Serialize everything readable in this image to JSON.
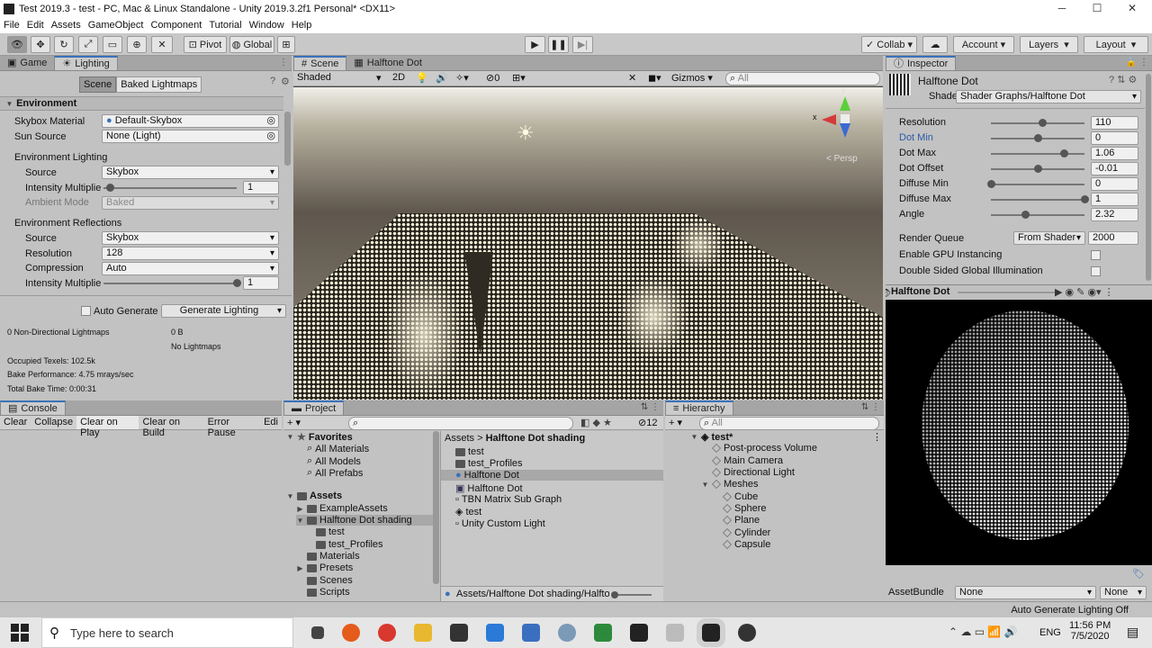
{
  "window": {
    "title": "Test 2019.3 - test - PC, Mac & Linux Standalone - Unity 2019.3.2f1 Personal* <DX11>",
    "min": "─",
    "max": "☐",
    "close": "✕"
  },
  "menu": [
    "File",
    "Edit",
    "Assets",
    "GameObject",
    "Component",
    "Tutorial",
    "Window",
    "Help"
  ],
  "toolbar": {
    "pivot": "Pivot",
    "global": "Global",
    "collab": "Collab",
    "account": "Account",
    "layers": "Layers",
    "layout": "Layout"
  },
  "lighting": {
    "tabs": [
      "Game",
      "Lighting"
    ],
    "subtabs": [
      "Scene",
      "Baked Lightmaps"
    ],
    "environment": "Environment",
    "skybox_label": "Skybox Material",
    "skybox_value": "Default-Skybox",
    "sun_label": "Sun Source",
    "sun_value": "None (Light)",
    "env_lighting": "Environment Lighting",
    "source_label": "Source",
    "source_value": "Skybox",
    "intensity_label": "Intensity Multiplie",
    "intensity_value": "1",
    "intensity_level": 0.05,
    "ambient_label": "Ambient Mode",
    "ambient_value": "Baked",
    "env_reflections": "Environment Reflections",
    "refl_source_label": "Source",
    "refl_source_value": "Skybox",
    "resolution_label": "Resolution",
    "resolution_value": "128",
    "compression_label": "Compression",
    "compression_value": "Auto",
    "refl_intensity_label": "Intensity Multiplie",
    "refl_intensity_value": "1",
    "refl_intensity_level": 1.0,
    "auto_generate": "Auto Generate",
    "generate": "Generate Lighting",
    "stats": {
      "nondir": "0 Non-Directional Lightmaps",
      "size": "0 B",
      "nolightmaps": "No Lightmaps",
      "texels": "Occupied Texels: 102.5k",
      "perf": "Bake Performance: 4.75 mrays/sec",
      "time": "Total Bake Time: 0:00:31"
    }
  },
  "scene": {
    "tabs": [
      "Scene",
      "Halftone Dot"
    ],
    "shading": "Shaded",
    "mode2d": "2D",
    "fx_count": "0",
    "gizmos": "Gizmos",
    "search": "All",
    "persp": "Persp",
    "axis_x": "x",
    "axis_y": "y"
  },
  "inspector": {
    "tab": "Inspector",
    "name": "Halftone Dot",
    "shader_label": "Shader",
    "shader_value": "Shader Graphs/Halftone Dot",
    "props": [
      {
        "label": "Resolution",
        "value": "110",
        "level": 0.55,
        "highlight": false
      },
      {
        "label": "Dot Min",
        "value": "0",
        "level": 0.5,
        "highlight": true
      },
      {
        "label": "Dot Max",
        "value": "1.06",
        "level": 0.78,
        "highlight": false
      },
      {
        "label": "Dot Offset",
        "value": "-0.01",
        "level": 0.5,
        "highlight": false
      },
      {
        "label": "Diffuse Min",
        "value": "0",
        "level": 0.0,
        "highlight": false
      },
      {
        "label": "Diffuse Max",
        "value": "1",
        "level": 1.0,
        "highlight": false
      },
      {
        "label": "Angle",
        "value": "2.32",
        "level": 0.37,
        "highlight": false
      }
    ],
    "render_queue_label": "Render Queue",
    "render_queue_mode": "From Shader",
    "render_queue_value": "2000",
    "gpu_instancing": "Enable GPU Instancing",
    "double_sided": "Double Sided Global Illumination",
    "preview_title": "Halftone Dot",
    "assetbundle_label": "AssetBundle",
    "assetbundle_value": "None",
    "assetbundle_variant": "None"
  },
  "console": {
    "tab": "Console",
    "buttons": [
      "Clear",
      "Collapse",
      "Clear on Play",
      "Clear on Build",
      "Error Pause",
      "Edi"
    ]
  },
  "project": {
    "tab": "Project",
    "count": "12",
    "favorites": "Favorites",
    "fav_items": [
      "All Materials",
      "All Models",
      "All Prefabs"
    ],
    "assets": "Assets",
    "asset_items": [
      "ExampleAssets",
      "Halftone Dot shading",
      "test",
      "test_Profiles",
      "Materials",
      "Presets",
      "Scenes",
      "Scripts"
    ],
    "breadcrumb": [
      "Assets",
      "Halftone Dot shading"
    ],
    "files": [
      "test",
      "test_Profiles",
      "Halftone Dot",
      "Halftone Dot",
      "TBN Matrix Sub Graph",
      "test",
      "Unity Custom Light"
    ],
    "path": "Assets/Halftone Dot shading/Halftor"
  },
  "hierarchy": {
    "tab": "Hierarchy",
    "search": "All",
    "scene": "test*",
    "items": [
      "Post-process Volume",
      "Main Camera",
      "Directional Light",
      "Meshes",
      "Cube",
      "Sphere",
      "Plane",
      "Cylinder",
      "Capsule"
    ]
  },
  "status": "Auto Generate Lighting Off",
  "taskbar": {
    "search": "Type here to search",
    "lang": "ENG",
    "time": "11:56 PM",
    "date": "7/5/2020"
  }
}
